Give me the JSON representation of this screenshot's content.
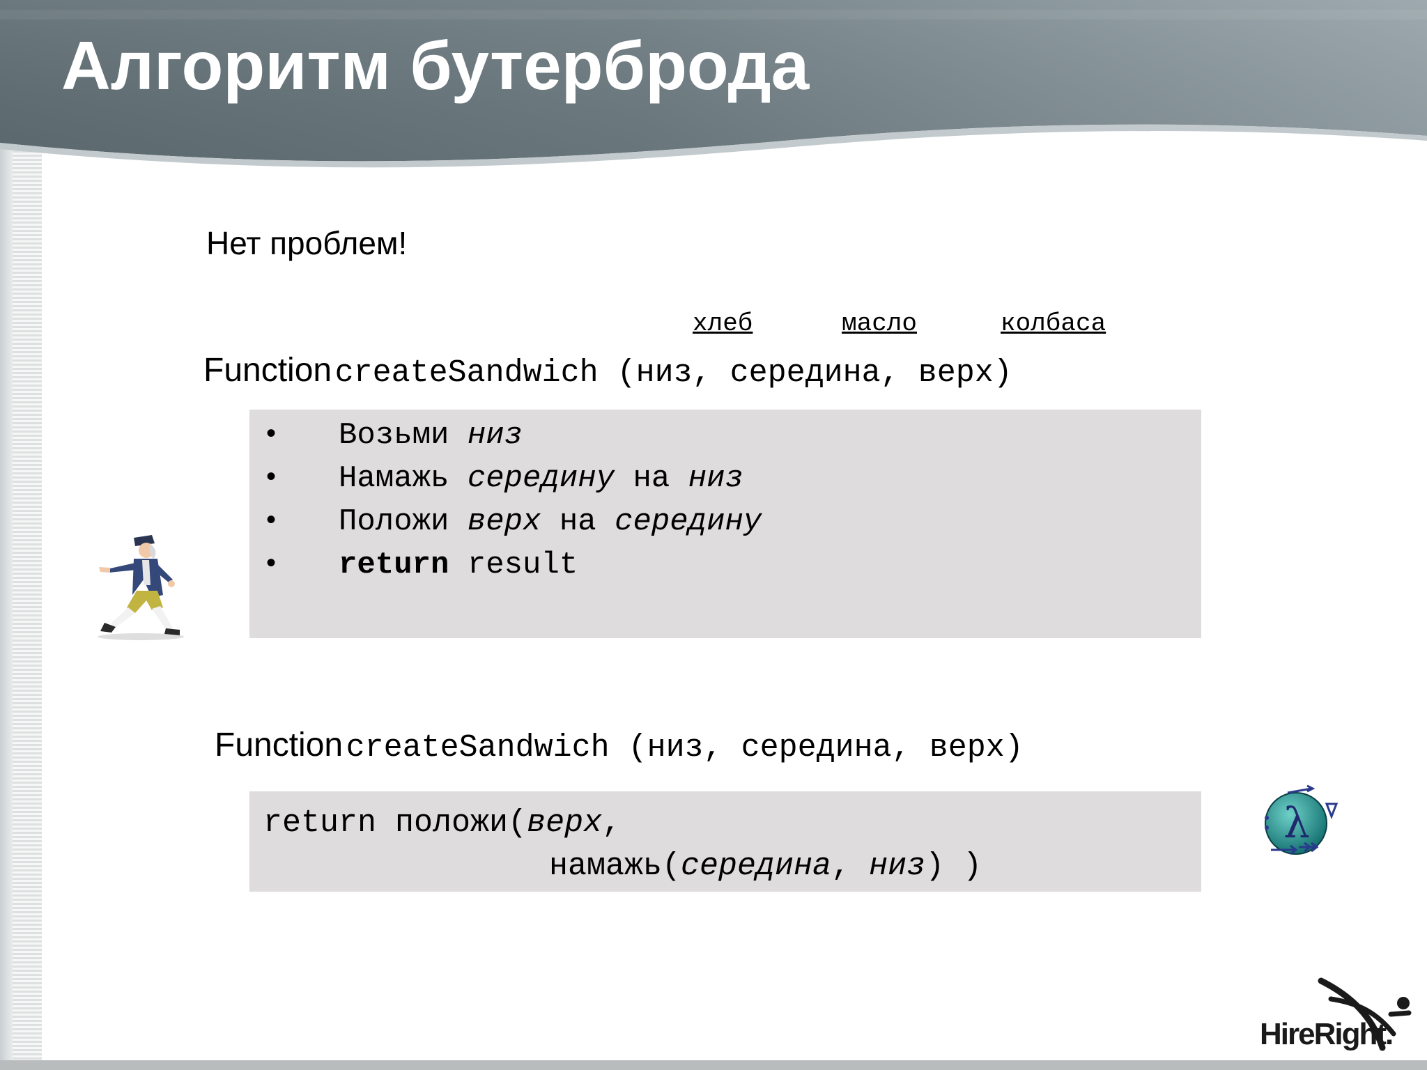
{
  "slide": {
    "title": "Алгоритм бутерброда",
    "intro": "Нет проблем!",
    "param_labels": [
      "хлеб",
      "масло",
      "колбаса"
    ],
    "function_keyword": "Function",
    "function_signature": "createSandwich (низ, середина, верх)",
    "steps": [
      {
        "bullet": "•",
        "parts": [
          {
            "text": "Возьми ",
            "style": "normal"
          },
          {
            "text": "низ",
            "style": "italic"
          }
        ]
      },
      {
        "bullet": "•",
        "parts": [
          {
            "text": "Намажь ",
            "style": "normal"
          },
          {
            "text": "середину",
            "style": "italic"
          },
          {
            "text": " на ",
            "style": "normal"
          },
          {
            "text": "низ",
            "style": "italic"
          }
        ]
      },
      {
        "bullet": "•",
        "parts": [
          {
            "text": "Положи ",
            "style": "normal"
          },
          {
            "text": "верх",
            "style": "italic"
          },
          {
            "text": " на ",
            "style": "normal"
          },
          {
            "text": "середину",
            "style": "italic"
          }
        ]
      },
      {
        "bullet": "•",
        "parts": [
          {
            "text": "return",
            "style": "bold"
          },
          {
            "text": " result",
            "style": "normal"
          }
        ]
      }
    ],
    "code": {
      "line1": [
        {
          "text": "return положи(",
          "style": "normal"
        },
        {
          "text": "верх",
          "style": "italic"
        },
        {
          "text": ",",
          "style": "normal"
        }
      ],
      "line2": [
        {
          "text": "намажь(",
          "style": "normal"
        },
        {
          "text": "середина",
          "style": "italic"
        },
        {
          "text": ", ",
          "style": "normal"
        },
        {
          "text": "низ",
          "style": "italic"
        },
        {
          "text": ") )",
          "style": "normal"
        }
      ]
    },
    "logo_text": "HireRight."
  },
  "colors": {
    "header_dark": "#5f6d73",
    "header_light": "#8e9ca1",
    "code_box": "#dedcdd",
    "text": "#000000"
  },
  "icons": [
    "walking-man-figure",
    "lambda-logo-icon",
    "hireright-logo"
  ]
}
